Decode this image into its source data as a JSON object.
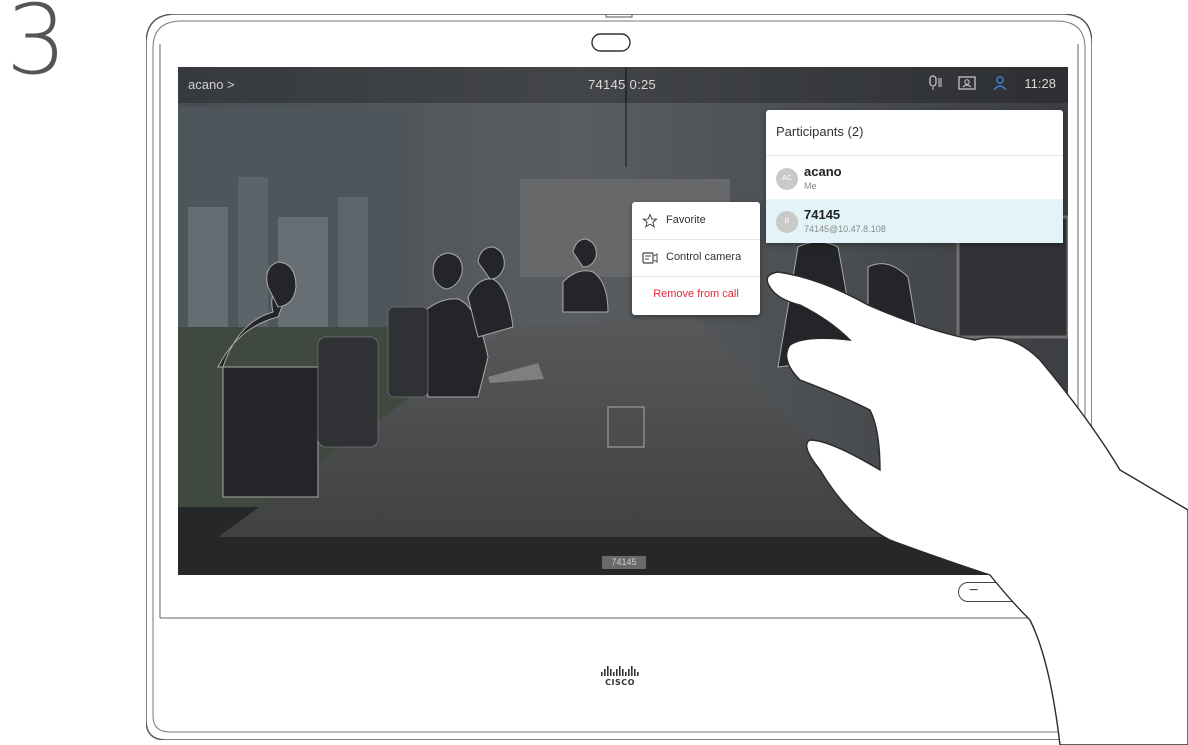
{
  "step_number": "3",
  "status_bar": {
    "caller": "acano >",
    "call_info": "74145 0:25",
    "time": "11:28",
    "icons": [
      "mic-icon",
      "selfview-icon",
      "participants-icon"
    ]
  },
  "participants": {
    "title": "Participants (2)",
    "items": [
      {
        "initials": "AC",
        "name": "acano",
        "sub": "Me",
        "selected": false
      },
      {
        "initials": "B",
        "name": "74145",
        "sub": "74145@10.47.8.108",
        "selected": true
      }
    ]
  },
  "context_menu": {
    "items": [
      {
        "label": "Favorite",
        "icon": "star-icon"
      },
      {
        "label": "Control camera",
        "icon": "camera-control-icon"
      },
      {
        "label": "Remove from call",
        "icon": "",
        "color": "#e0293a"
      }
    ]
  },
  "video_label": "74145",
  "volume": {
    "minus": "−",
    "plus": "+"
  },
  "brand": {
    "text": "CISCO"
  },
  "colors": {
    "accent_blue": "#3b83d6",
    "selected_row": "#e2f4f8",
    "remove_red": "#e0293a"
  }
}
